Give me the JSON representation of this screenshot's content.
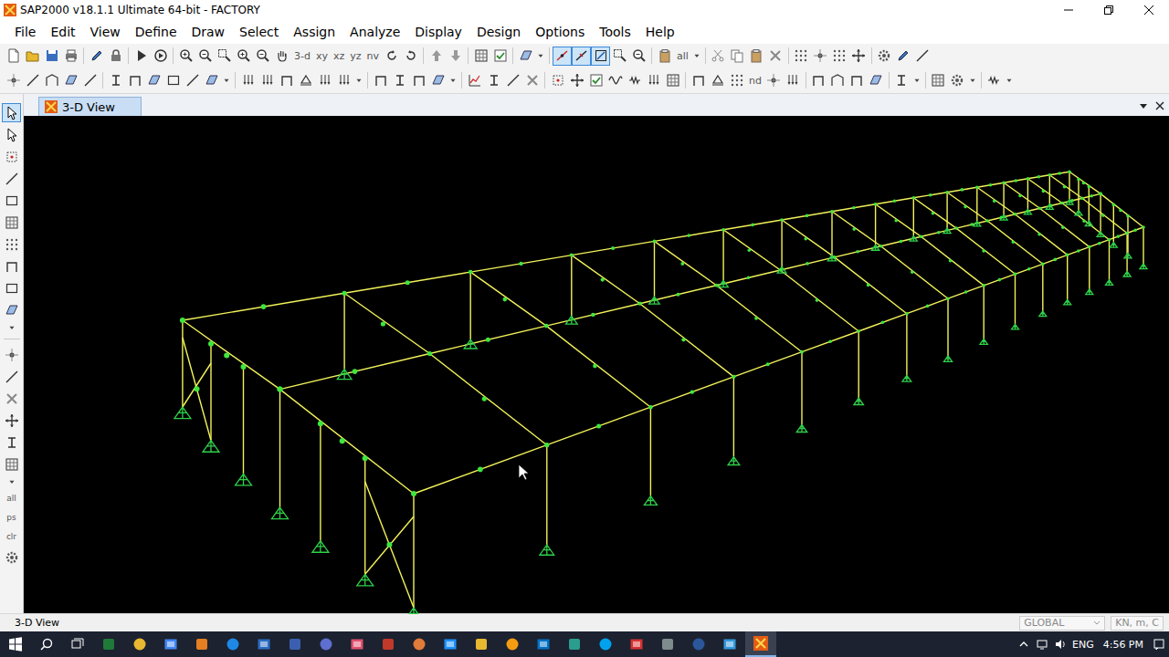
{
  "window": {
    "title": "SAP2000 v18.1.1 Ultimate 64-bit - FACTORY"
  },
  "menu": [
    "File",
    "Edit",
    "View",
    "Define",
    "Draw",
    "Select",
    "Assign",
    "Analyze",
    "Display",
    "Design",
    "Options",
    "Tools",
    "Help"
  ],
  "toolbar": {
    "view_buttons": [
      "3-d",
      "xy",
      "xz",
      "yz",
      "nv"
    ],
    "select_all": "all",
    "node_button": "nd",
    "snap_toggles": [
      {
        "selected": true
      },
      {
        "selected": true
      },
      {
        "selected": true
      }
    ]
  },
  "side_toolbar": {
    "pointer": {
      "selected": true
    },
    "labels": [
      "all",
      "ps",
      "clr"
    ]
  },
  "tabs": [
    {
      "label": "3-D View",
      "selected": true
    }
  ],
  "status_bar": {
    "view": "3-D View",
    "coordinate_system": {
      "value": "GLOBAL",
      "disabled": true
    },
    "units": {
      "value": "KN, m, C",
      "disabled": true
    }
  },
  "taskbar": {
    "language": "ENG",
    "time": "4:56 PM"
  }
}
